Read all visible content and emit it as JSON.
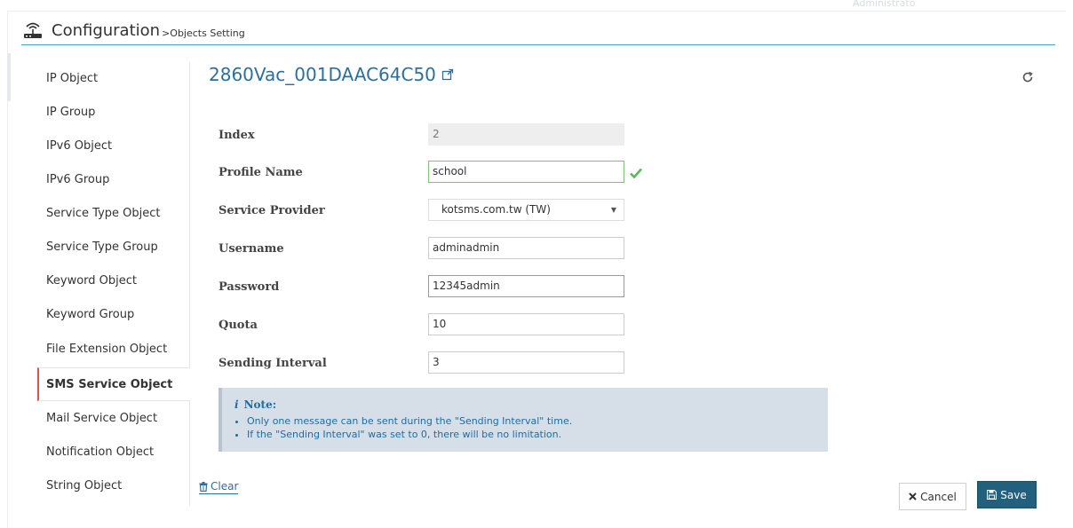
{
  "header": {
    "title": "Configuration",
    "breadcrumb": ">Objects Setting",
    "user_hint": "Administrato"
  },
  "sidebar": {
    "items": [
      {
        "label": "IP Object"
      },
      {
        "label": "IP Group"
      },
      {
        "label": "IPv6 Object"
      },
      {
        "label": "IPv6 Group"
      },
      {
        "label": "Service Type Object"
      },
      {
        "label": "Service Type Group"
      },
      {
        "label": "Keyword Object"
      },
      {
        "label": "Keyword Group"
      },
      {
        "label": "File Extension Object"
      },
      {
        "label": "SMS Service Object"
      },
      {
        "label": "Mail Service Object"
      },
      {
        "label": "Notification Object"
      },
      {
        "label": "String Object"
      }
    ],
    "active": "SMS Service Object"
  },
  "main": {
    "object_title": "2860Vac_001DAAC64C50",
    "form": {
      "index": {
        "label": "Index",
        "value": "2"
      },
      "profile_name": {
        "label": "Profile Name",
        "value": "school"
      },
      "service_provider": {
        "label": "Service Provider",
        "value": "kotsms.com.tw (TW)"
      },
      "username": {
        "label": "Username",
        "value": "adminadmin"
      },
      "password": {
        "label": "Password",
        "value": "12345admin"
      },
      "quota": {
        "label": "Quota",
        "value": "10"
      },
      "sending_interval": {
        "label": "Sending Interval",
        "value": "3"
      }
    },
    "note": {
      "title": "Note:",
      "items": [
        "Only one message can be sent during the \"Sending Interval\" time.",
        "If the \"Sending Interval\" was set to 0, there will be no limitation."
      ]
    },
    "clear_label": "Clear",
    "cancel_label": "Cancel",
    "save_label": "Save"
  },
  "colors": {
    "accent": "#2d6f9c",
    "save_button": "#22607d",
    "active_marker": "#d9534f",
    "valid": "#7cc576",
    "note_bg": "#d6dfe7"
  }
}
